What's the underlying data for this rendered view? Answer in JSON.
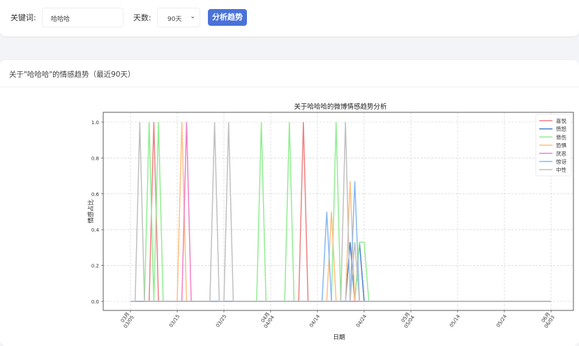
{
  "search": {
    "keyword_label": "关键词:",
    "keyword_value": "哈哈哈",
    "days_label": "天数:",
    "days_value": "90天",
    "analyze_button": "分析趋势"
  },
  "result": {
    "title": "关于\"哈哈哈\"的情感趋势（最近90天）"
  },
  "chart_data": {
    "type": "line",
    "title": "关于哈哈哈的微博情感趋势分析",
    "xlabel": "日期",
    "ylabel": "情感占比",
    "ylim": [
      0,
      1.0
    ],
    "yticks": [
      "0.0",
      "0.2",
      "0.4",
      "0.6",
      "0.8",
      "1.0"
    ],
    "x_range": [
      "03/05",
      "06/03"
    ],
    "xticks": [
      {
        "day": 0,
        "month": "03月",
        "label": "03/05"
      },
      {
        "day": 10,
        "label": "03/15"
      },
      {
        "day": 20,
        "label": "03/25"
      },
      {
        "day": 30,
        "month": "04月",
        "label": "04/04"
      },
      {
        "day": 40,
        "label": "04/14"
      },
      {
        "day": 50,
        "label": "04/24"
      },
      {
        "day": 60,
        "month": "05月",
        "label": "05/04"
      },
      {
        "day": 70,
        "label": "05/14"
      },
      {
        "day": 80,
        "label": "05/24"
      },
      {
        "day": 90,
        "month": "06月",
        "label": "06/03"
      }
    ],
    "grid": true,
    "legend_position": "top-right",
    "num_days": 91,
    "note_points": "points are [day offset from 03/05, value]; all other days are 0",
    "series": [
      {
        "name": "喜悦",
        "color": "#f08080",
        "points": [
          [
            5,
            1.0
          ],
          [
            37,
            1.0
          ]
        ]
      },
      {
        "name": "愤怒",
        "color": "#4a7fd0",
        "points": [
          [
            47,
            0.33
          ],
          [
            49,
            0.33
          ]
        ]
      },
      {
        "name": "悲伤",
        "color": "#90ee90",
        "points": [
          [
            4,
            1.0
          ],
          [
            6,
            1.0
          ],
          [
            28,
            1.0
          ],
          [
            34,
            1.0
          ],
          [
            44,
            1.0
          ],
          [
            49,
            0.33
          ],
          [
            50,
            0.33
          ]
        ]
      },
      {
        "name": "恐惧",
        "color": "#ffbf80",
        "points": [
          [
            11,
            1.0
          ],
          [
            43,
            0.5
          ],
          [
            47,
            0.67
          ]
        ]
      },
      {
        "name": "厌恶",
        "color": "#f080c8",
        "points": [
          [
            12,
            1.0
          ]
        ]
      },
      {
        "name": "惊讶",
        "color": "#87b8f0",
        "points": [
          [
            42,
            0.5
          ],
          [
            48,
            0.67
          ]
        ]
      },
      {
        "name": "中性",
        "color": "#c0c0c0",
        "points": [
          [
            2,
            1.0
          ],
          [
            18,
            1.0
          ],
          [
            21,
            1.0
          ],
          [
            46,
            1.0
          ],
          [
            48,
            0.33
          ]
        ]
      }
    ]
  }
}
